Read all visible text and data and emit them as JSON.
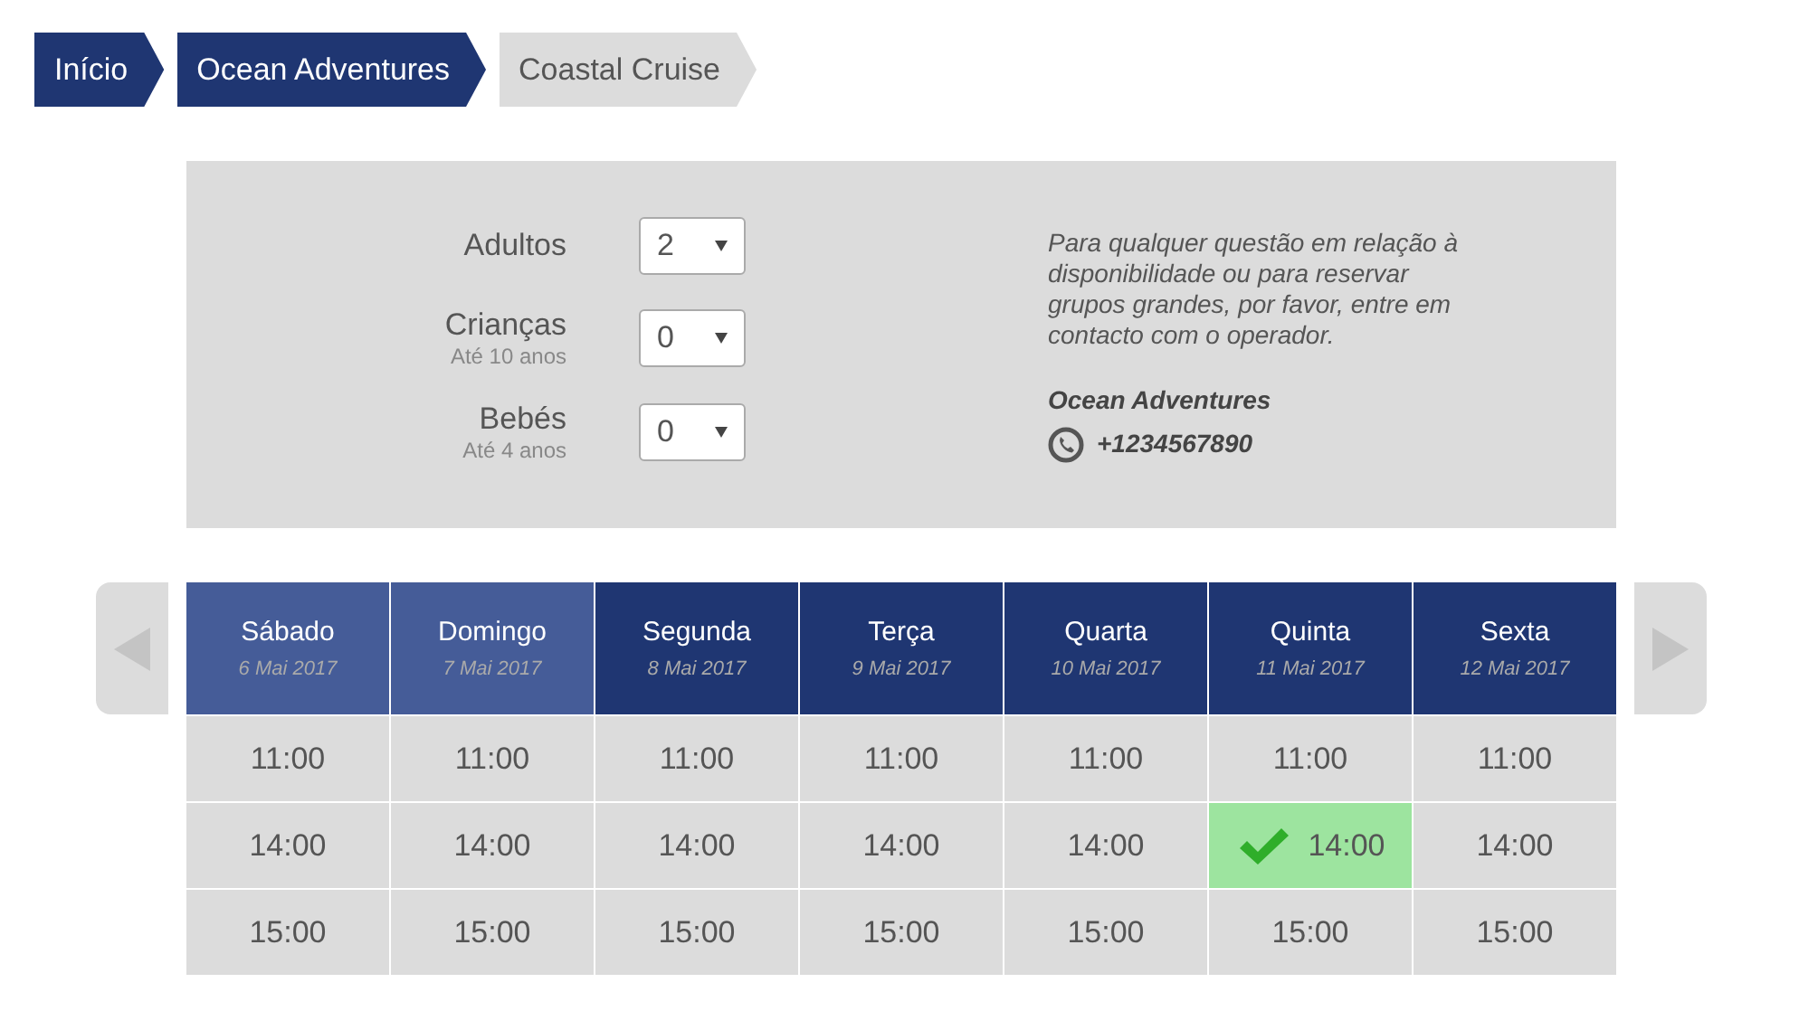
{
  "breadcrumb": [
    {
      "label": "Início",
      "current": false
    },
    {
      "label": "Ocean Adventures",
      "current": false
    },
    {
      "label": "Coastal Cruise",
      "current": true
    }
  ],
  "guests": [
    {
      "label": "Adultos",
      "value": "2"
    },
    {
      "label": "Crianças",
      "note": "Até 10 anos",
      "value": "0"
    },
    {
      "label": "Bebés",
      "note": "Até 4 anos",
      "value": "0"
    }
  ],
  "info": {
    "text": "Para qualquer questão em relação à disponibilidade ou para reservar grupos grandes, por favor, entre em contacto com o operador.",
    "operator": "Ocean Adventures",
    "phone": "+1234567890"
  },
  "days": [
    {
      "name": "Sábado",
      "date": "6 Mai 2017",
      "weekend": true,
      "slots": [
        {
          "time": "11:00",
          "selected": false
        },
        {
          "time": "14:00",
          "selected": false
        },
        {
          "time": "15:00",
          "selected": false
        }
      ]
    },
    {
      "name": "Domingo",
      "date": "7 Mai 2017",
      "weekend": true,
      "slots": [
        {
          "time": "11:00",
          "selected": false
        },
        {
          "time": "14:00",
          "selected": false
        },
        {
          "time": "15:00",
          "selected": false
        }
      ]
    },
    {
      "name": "Segunda",
      "date": "8 Mai 2017",
      "weekend": false,
      "slots": [
        {
          "time": "11:00",
          "selected": false
        },
        {
          "time": "14:00",
          "selected": false
        },
        {
          "time": "15:00",
          "selected": false
        }
      ]
    },
    {
      "name": "Terça",
      "date": "9 Mai 2017",
      "weekend": false,
      "slots": [
        {
          "time": "11:00",
          "selected": false
        },
        {
          "time": "14:00",
          "selected": false
        },
        {
          "time": "15:00",
          "selected": false
        }
      ]
    },
    {
      "name": "Quarta",
      "date": "10 Mai 2017",
      "weekend": false,
      "slots": [
        {
          "time": "11:00",
          "selected": false
        },
        {
          "time": "14:00",
          "selected": false
        },
        {
          "time": "15:00",
          "selected": false
        }
      ]
    },
    {
      "name": "Quinta",
      "date": "11 Mai 2017",
      "weekend": false,
      "slots": [
        {
          "time": "11:00",
          "selected": false
        },
        {
          "time": "14:00",
          "selected": true
        },
        {
          "time": "15:00",
          "selected": false
        }
      ]
    },
    {
      "name": "Sexta",
      "date": "12 Mai 2017",
      "weekend": false,
      "slots": [
        {
          "time": "11:00",
          "selected": false
        },
        {
          "time": "14:00",
          "selected": false
        },
        {
          "time": "15:00",
          "selected": false
        }
      ]
    }
  ]
}
